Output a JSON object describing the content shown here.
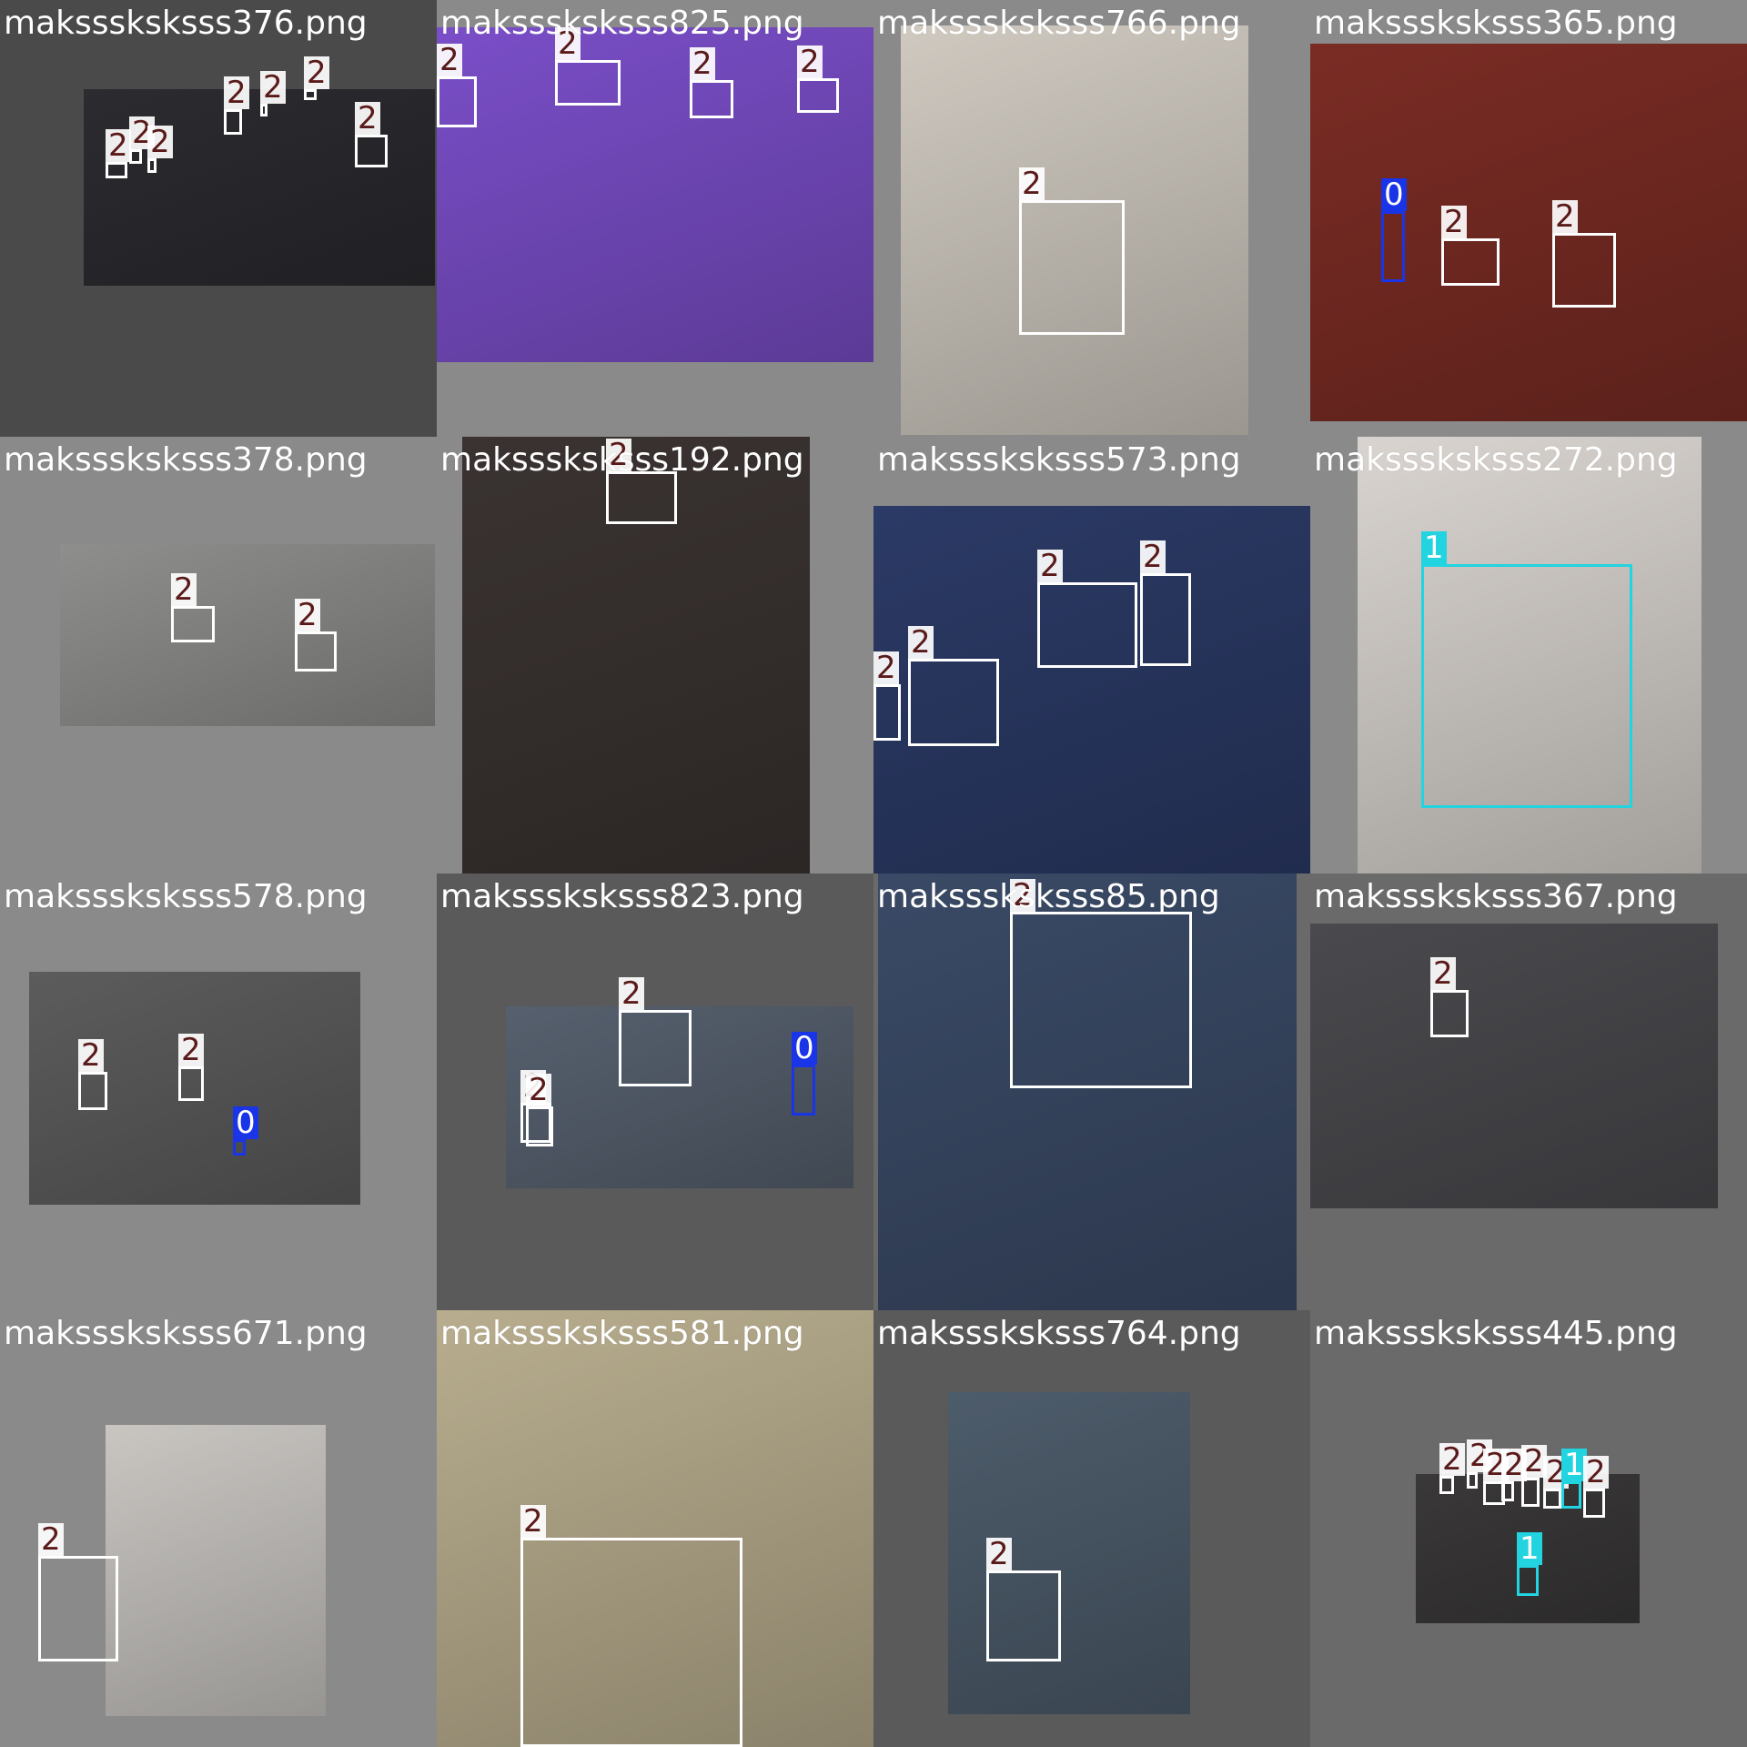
{
  "colors": {
    "class0": "#1a34e8",
    "class1": "#22d3e0",
    "class2": "#ffffff",
    "label_text": "#5a1a1a"
  },
  "tiles": [
    {
      "filename": "maksssksksss376.png",
      "tile_bg": "#4a4a4a",
      "photo_bg": "#2b2b30",
      "detections": [
        {
          "cls": 2,
          "label": "2"
        },
        {
          "cls": 2,
          "label": "2"
        },
        {
          "cls": 2,
          "label": "2"
        },
        {
          "cls": 2,
          "label": "2"
        },
        {
          "cls": 2,
          "label": "2"
        },
        {
          "cls": 2,
          "label": "2"
        },
        {
          "cls": 2,
          "label": "2"
        }
      ]
    },
    {
      "filename": "maksssksksss825.png",
      "tile_bg": "#8a8a8a",
      "photo_bg": "#7a4ec8",
      "detections": [
        {
          "cls": 2,
          "label": "2"
        },
        {
          "cls": 2,
          "label": "2"
        },
        {
          "cls": 2,
          "label": "2"
        },
        {
          "cls": 2,
          "label": "2"
        }
      ]
    },
    {
      "filename": "maksssksksss766.png",
      "tile_bg": "#8a8a8a",
      "photo_bg": "#cfc9c0",
      "detections": [
        {
          "cls": 2,
          "label": "2"
        }
      ]
    },
    {
      "filename": "maksssksksss365.png",
      "tile_bg": "#8a8a8a",
      "photo_bg": "#7a2c24",
      "detections": [
        {
          "cls": 0,
          "label": "0"
        },
        {
          "cls": 2,
          "label": "2"
        },
        {
          "cls": 2,
          "label": "2"
        }
      ]
    },
    {
      "filename": "maksssksksss378.png",
      "tile_bg": "#8a8a8a",
      "photo_bg": "#8e8f8c",
      "detections": [
        {
          "cls": 2,
          "label": "2"
        },
        {
          "cls": 2,
          "label": "2"
        }
      ]
    },
    {
      "filename": "maksssksksss192.png",
      "tile_bg": "#8a8a8a",
      "photo_bg": "#3a3331",
      "detections": [
        {
          "cls": 2,
          "label": "2"
        }
      ]
    },
    {
      "filename": "maksssksksss573.png",
      "tile_bg": "#8a8a8a",
      "photo_bg": "#2b3a66",
      "detections": [
        {
          "cls": 2,
          "label": "2"
        },
        {
          "cls": 2,
          "label": "2"
        },
        {
          "cls": 2,
          "label": "2"
        },
        {
          "cls": 2,
          "label": "2"
        }
      ]
    },
    {
      "filename": "maksssksksss272.png",
      "tile_bg": "#8a8a8a",
      "photo_bg": "#d9d4cf",
      "detections": [
        {
          "cls": 1,
          "label": "1"
        }
      ]
    },
    {
      "filename": "maksssksksss578.png",
      "tile_bg": "#8a8a8a",
      "photo_bg": "#5c5c5c",
      "detections": [
        {
          "cls": 2,
          "label": "2"
        },
        {
          "cls": 2,
          "label": "2"
        },
        {
          "cls": 0,
          "label": "0"
        }
      ]
    },
    {
      "filename": "maksssksksss823.png",
      "tile_bg": "#5a5a5a",
      "photo_bg": "#56606e",
      "detections": [
        {
          "cls": 2,
          "label": "2"
        },
        {
          "cls": 2,
          "label": "2"
        },
        {
          "cls": 2,
          "label": "2"
        },
        {
          "cls": 0,
          "label": "0"
        }
      ]
    },
    {
      "filename": "maksssksksss85.png",
      "tile_bg": "#6a6a6a",
      "photo_bg": "#3a4a66",
      "detections": [
        {
          "cls": 2,
          "label": "2"
        }
      ]
    },
    {
      "filename": "maksssksksss367.png",
      "tile_bg": "#6a6a6a",
      "photo_bg": "#4a4a4e",
      "detections": [
        {
          "cls": 2,
          "label": "2"
        }
      ]
    },
    {
      "filename": "maksssksksss671.png",
      "tile_bg": "#8a8a8a",
      "photo_bg": "#c9c6c2",
      "detections": [
        {
          "cls": 2,
          "label": "2"
        }
      ]
    },
    {
      "filename": "maksssksksss581.png",
      "tile_bg": "#8a8a8a",
      "photo_bg": "#b8ad8e",
      "detections": [
        {
          "cls": 2,
          "label": "2"
        }
      ]
    },
    {
      "filename": "maksssksksss764.png",
      "tile_bg": "#5a5a5a",
      "photo_bg": "#4d5c6b",
      "detections": [
        {
          "cls": 2,
          "label": "2"
        }
      ]
    },
    {
      "filename": "maksssksksss445.png",
      "tile_bg": "#6a6a6a",
      "photo_bg": "#3a3838",
      "detections": [
        {
          "cls": 2,
          "label": "2"
        },
        {
          "cls": 2,
          "label": "2"
        },
        {
          "cls": 2,
          "label": "2"
        },
        {
          "cls": 2,
          "label": "2"
        },
        {
          "cls": 2,
          "label": "2"
        },
        {
          "cls": 2,
          "label": "2"
        },
        {
          "cls": 1,
          "label": "1"
        },
        {
          "cls": 2,
          "label": "2"
        },
        {
          "cls": 1,
          "label": "1"
        }
      ]
    }
  ]
}
